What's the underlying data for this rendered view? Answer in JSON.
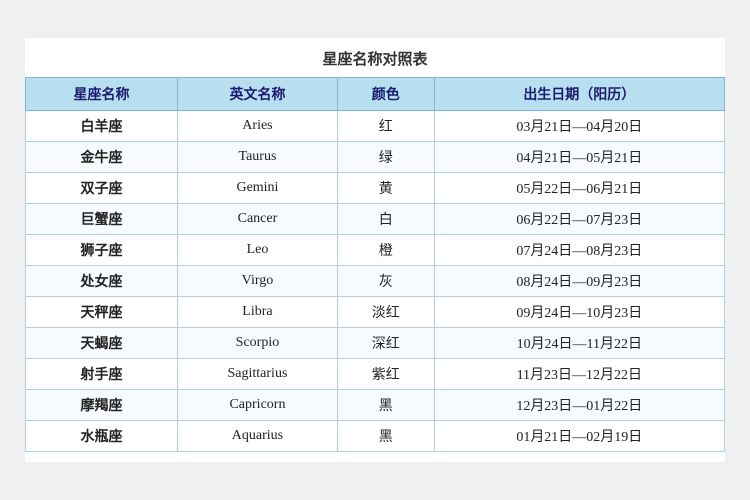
{
  "title": "星座名称对照表",
  "headers": [
    "星座名称",
    "英文名称",
    "颜色",
    "出生日期（阳历）"
  ],
  "rows": [
    {
      "chinese": "白羊座",
      "english": "Aries",
      "color": "红",
      "date": "03月21日—04月20日"
    },
    {
      "chinese": "金牛座",
      "english": "Taurus",
      "color": "绿",
      "date": "04月21日—05月21日"
    },
    {
      "chinese": "双子座",
      "english": "Gemini",
      "color": "黄",
      "date": "05月22日—06月21日"
    },
    {
      "chinese": "巨蟹座",
      "english": "Cancer",
      "color": "白",
      "date": "06月22日—07月23日"
    },
    {
      "chinese": "狮子座",
      "english": "Leo",
      "color": "橙",
      "date": "07月24日—08月23日"
    },
    {
      "chinese": "处女座",
      "english": "Virgo",
      "color": "灰",
      "date": "08月24日—09月23日"
    },
    {
      "chinese": "天秤座",
      "english": "Libra",
      "color": "淡红",
      "date": "09月24日—10月23日"
    },
    {
      "chinese": "天蝎座",
      "english": "Scorpio",
      "color": "深红",
      "date": "10月24日—11月22日"
    },
    {
      "chinese": "射手座",
      "english": "Sagittarius",
      "color": "紫红",
      "date": "11月23日—12月22日"
    },
    {
      "chinese": "摩羯座",
      "english": "Capricorn",
      "color": "黑",
      "date": "12月23日—01月22日"
    },
    {
      "chinese": "水瓶座",
      "english": "Aquarius",
      "color": "黑",
      "date": "01月21日—02月19日"
    }
  ]
}
